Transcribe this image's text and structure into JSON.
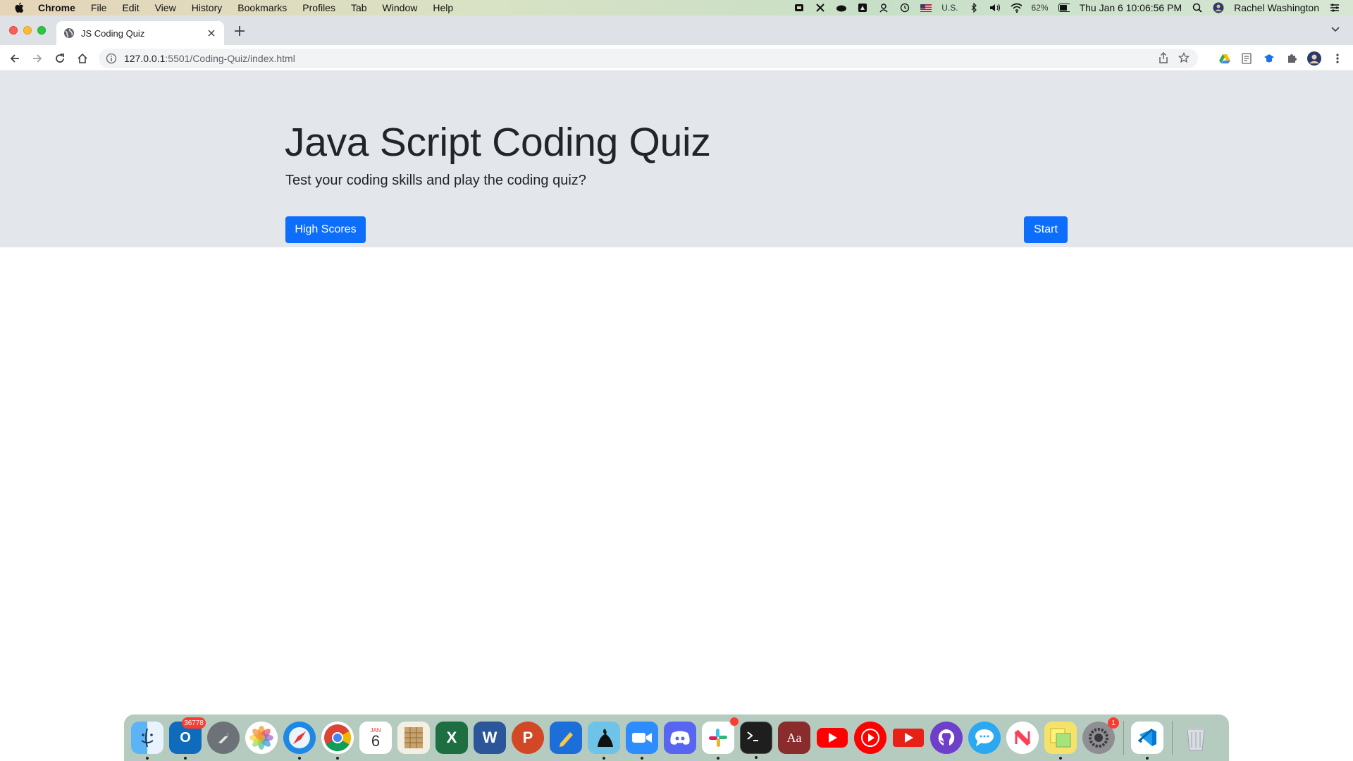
{
  "menubar": {
    "app_name": "Chrome",
    "items": [
      "File",
      "Edit",
      "View",
      "History",
      "Bookmarks",
      "Profiles",
      "Tab",
      "Window",
      "Help"
    ],
    "input_source": "U.S.",
    "battery": "62%",
    "datetime": "Thu Jan 6  10:06:56 PM",
    "user": "Rachel Washington"
  },
  "browser": {
    "tab_title": "JS Coding Quiz",
    "url_host": "127.0.0.1",
    "url_path": ":5501/Coding-Quiz/index.html"
  },
  "page": {
    "title": "Java Script Coding Quiz",
    "lead": "Test your coding skills and play the coding quiz?",
    "high_scores_label": "High Scores",
    "start_label": "Start",
    "accent": "#0d6efd",
    "jumbotron_bg": "#e3e6ea"
  },
  "dock": {
    "calendar_month": "JAN",
    "calendar_day": "6",
    "outlook_badge": "36778",
    "slack_badge": "",
    "system_prefs_badge": "1",
    "apps": [
      "finder",
      "outlook",
      "launchpad",
      "photos",
      "safari",
      "chrome",
      "calendar",
      "numbers",
      "excel",
      "word",
      "powerpoint",
      "pencil",
      "kindle",
      "zoom",
      "discord",
      "slack",
      "terminal",
      "dictionary",
      "youtube",
      "youtube-music",
      "youtube-red",
      "github-desktop",
      "messenger",
      "news",
      "stickies",
      "system-preferences",
      "vscode",
      "trash"
    ]
  }
}
